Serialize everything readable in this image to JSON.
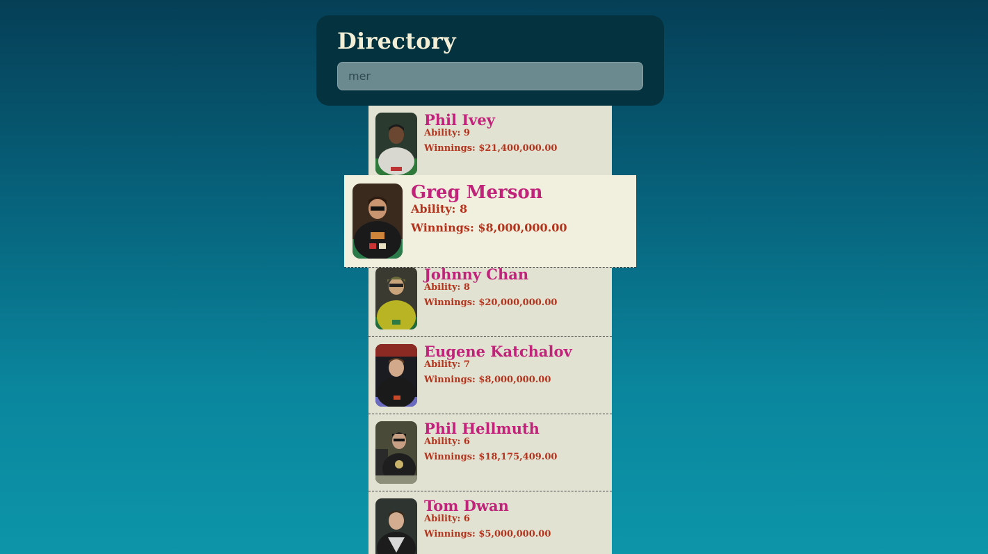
{
  "header": {
    "title": "Directory",
    "search_value": "mer"
  },
  "players": [
    {
      "name": "Phil Ivey",
      "ability": "Ability: 9",
      "winnings": "Winnings: $21,400,000.00"
    },
    {
      "name": "Greg Merson",
      "ability": "Ability: 8",
      "winnings": "Winnings: $8,000,000.00"
    },
    {
      "name": "Johnny Chan",
      "ability": "Ability: 8",
      "winnings": "Winnings: $20,000,000.00"
    },
    {
      "name": "Eugene Katchalov",
      "ability": "Ability: 7",
      "winnings": "Winnings: $8,000,000.00"
    },
    {
      "name": "Phil Hellmuth",
      "ability": "Ability: 6",
      "winnings": "Winnings: $18,175,409.00"
    },
    {
      "name": "Tom Dwan",
      "ability": "Ability: 6",
      "winnings": "Winnings: $5,000,000.00"
    }
  ],
  "colors": {
    "name": "#c2237a",
    "detail": "#b3341d",
    "card_bg": "#e1e2d2",
    "highlight_bg": "#f1efdd",
    "header_bg": "#04333f"
  }
}
